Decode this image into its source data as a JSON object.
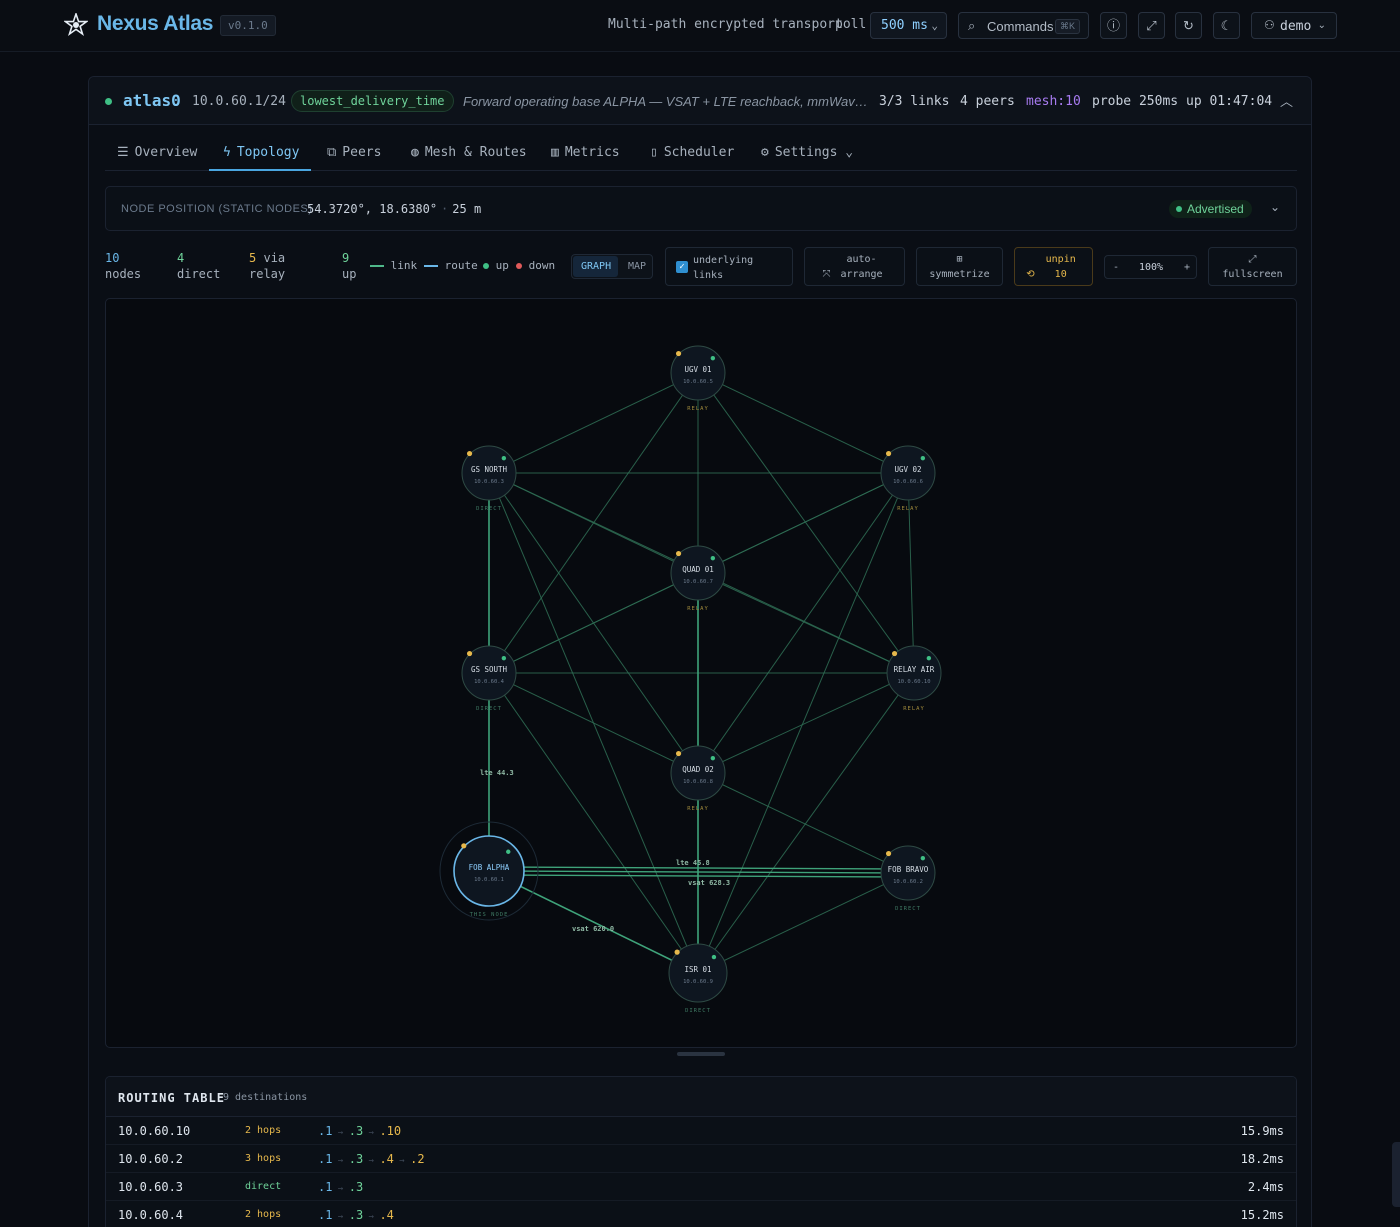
{
  "header": {
    "brand": "Nexus Atlas",
    "version": "v0.1.0",
    "tagline": "Multi-path encrypted transport",
    "poll_label": "poll",
    "poll_value": "500 ms",
    "commands_label": "Commands",
    "commands_shortcut": "⌘K",
    "user": "demo"
  },
  "interface": {
    "name": "atlas0",
    "address": "10.0.60.1/24",
    "policy": "lowest_delivery_time",
    "description": "Forward operating base ALPHA — VSAT + LTE reachback, mmWave sh...",
    "links": "3/3 links",
    "peers": "4 peers",
    "mesh": "mesh:10",
    "probe": "probe 250ms",
    "uptime": "up 01:47:04"
  },
  "tabs": [
    {
      "label": "Overview",
      "icon": "list-icon"
    },
    {
      "label": "Topology",
      "icon": "bolt-icon"
    },
    {
      "label": "Peers",
      "icon": "network-icon"
    },
    {
      "label": "Mesh & Routes",
      "icon": "globe-icon"
    },
    {
      "label": "Metrics",
      "icon": "bar-chart-icon"
    },
    {
      "label": "Scheduler",
      "icon": "clipboard-icon"
    },
    {
      "label": "Settings",
      "icon": "gear-icon"
    }
  ],
  "active_tab": "Topology",
  "node_position": {
    "label": "NODE POSITION (STATIC NODES)",
    "coords": "54.3720°, 18.6380°",
    "altitude": "25 m",
    "status": "Advertised"
  },
  "stats": [
    {
      "num": "10",
      "label": "nodes",
      "color": "#6ab7e8"
    },
    {
      "num": "4",
      "label": "direct",
      "color": "#6fd39a"
    },
    {
      "num": "5",
      "label": "via relay",
      "color": "#e6b84c"
    },
    {
      "num": "9",
      "label": "up",
      "color": "#6fd39a"
    }
  ],
  "legend": {
    "link": "link",
    "route": "route",
    "up": "up",
    "down": "down"
  },
  "view_toggle": {
    "graph": "GRAPH",
    "map": "MAP"
  },
  "controls": {
    "underlying_links": "underlying links",
    "auto_arrange": "auto-arrange",
    "symmetrize": "symmetrize",
    "unpin": "unpin 10",
    "zoom_minus": "-",
    "zoom": "100%",
    "zoom_plus": "+",
    "fullscreen": "fullscreen"
  },
  "nodes": [
    {
      "id": "ugv01",
      "name": "UGV 01",
      "ip": "10.0.60.5",
      "role": "RELAY"
    },
    {
      "id": "gsnorth",
      "name": "GS NORTH",
      "ip": "10.0.60.3",
      "role": "DIRECT"
    },
    {
      "id": "ugv02",
      "name": "UGV 02",
      "ip": "10.0.60.6",
      "role": "RELAY"
    },
    {
      "id": "quad01",
      "name": "QUAD 01",
      "ip": "10.0.60.7",
      "role": "RELAY"
    },
    {
      "id": "gssouth",
      "name": "GS SOUTH",
      "ip": "10.0.60.4",
      "role": "DIRECT"
    },
    {
      "id": "relayair",
      "name": "RELAY AIR",
      "ip": "10.0.60.10",
      "role": "RELAY"
    },
    {
      "id": "quad02",
      "name": "QUAD 02",
      "ip": "10.0.60.8",
      "role": "RELAY"
    },
    {
      "id": "fobalpha",
      "name": "FOB ALPHA",
      "ip": "10.0.60.1",
      "role": "THIS NODE"
    },
    {
      "id": "fobbravo",
      "name": "FOB BRAVO",
      "ip": "10.0.60.2",
      "role": "DIRECT"
    },
    {
      "id": "isr01",
      "name": "ISR 01",
      "ip": "10.0.60.9",
      "role": "DIRECT"
    }
  ],
  "edge_labels": {
    "lte_left": "lte",
    "lte_left_val": "44.3",
    "lte_mid": "lte",
    "lte_mid_val": "45.8",
    "vsat_mid": "vsat",
    "vsat_mid_val": "628.3",
    "vsat_low": "vsat",
    "vsat_low_val": "620.0"
  },
  "routing_table": {
    "title": "ROUTING TABLE",
    "count": "9 destinations",
    "rows": [
      {
        "dest": "10.0.60.10",
        "hops": "2 hops",
        "path": [
          ".1",
          ".3",
          ".10"
        ],
        "latency": "15.9ms"
      },
      {
        "dest": "10.0.60.2",
        "hops": "3 hops",
        "path": [
          ".1",
          ".3",
          ".4",
          ".2"
        ],
        "latency": "18.2ms"
      },
      {
        "dest": "10.0.60.3",
        "hops": "direct",
        "path": [
          ".1",
          ".3"
        ],
        "latency": "2.4ms"
      },
      {
        "dest": "10.0.60.4",
        "hops": "2 hops",
        "path": [
          ".1",
          ".3",
          ".4"
        ],
        "latency": "15.2ms"
      }
    ]
  }
}
